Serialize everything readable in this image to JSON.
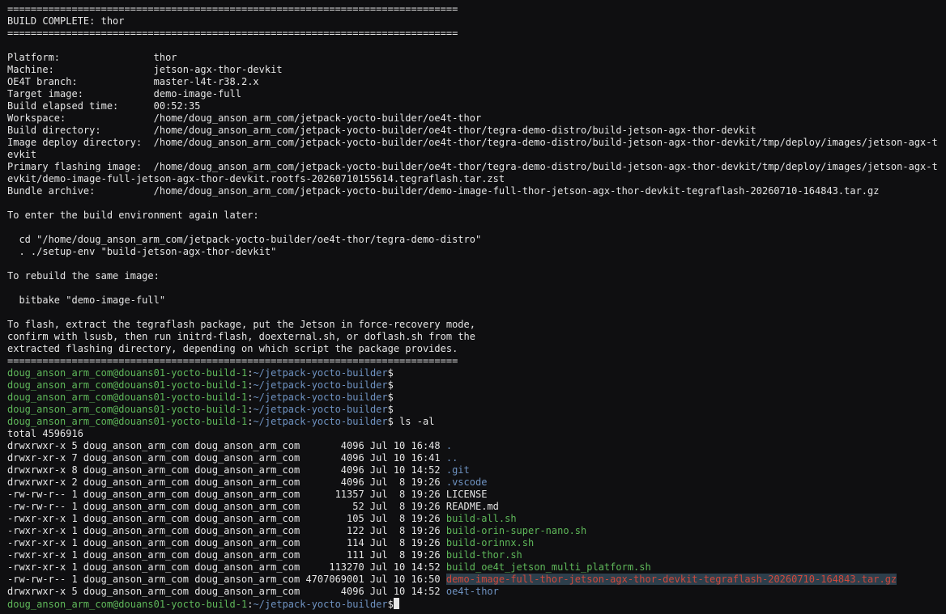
{
  "terminal": {
    "lines": [
      "=============================================================================",
      "BUILD COMPLETE: thor",
      "=============================================================================",
      "",
      "Platform:                thor",
      "Machine:                 jetson-agx-thor-devkit",
      "OE4T branch:             master-l4t-r38.2.x",
      "Target image:            demo-image-full",
      "Build elapsed time:      00:52:35",
      "Workspace:               /home/doug_anson_arm_com/jetpack-yocto-builder/oe4t-thor",
      "Build directory:         /home/doug_anson_arm_com/jetpack-yocto-builder/oe4t-thor/tegra-demo-distro/build-jetson-agx-thor-devkit",
      "Image deploy directory:  /home/doug_anson_arm_com/jetpack-yocto-builder/oe4t-thor/tegra-demo-distro/build-jetson-agx-thor-devkit/tmp/deploy/images/jetson-agx-thor-d",
      "evkit",
      "Primary flashing image:  /home/doug_anson_arm_com/jetpack-yocto-builder/oe4t-thor/tegra-demo-distro/build-jetson-agx-thor-devkit/tmp/deploy/images/jetson-agx-thor-d",
      "evkit/demo-image-full-jetson-agx-thor-devkit.rootfs-20260710155614.tegraflash.tar.zst",
      "Bundle archive:          /home/doug_anson_arm_com/jetpack-yocto-builder/demo-image-full-thor-jetson-agx-thor-devkit-tegraflash-20260710-164843.tar.gz",
      "",
      "To enter the build environment again later:",
      "",
      "  cd \"/home/doug_anson_arm_com/jetpack-yocto-builder/oe4t-thor/tegra-demo-distro\"",
      "  . ./setup-env \"build-jetson-agx-thor-devkit\"",
      "",
      "To rebuild the same image:",
      "",
      "  bitbake \"demo-image-full\"",
      "",
      "To flash, extract the tegraflash package, put the Jetson in force-recovery mode,",
      "confirm with lsusb, then run initrd-flash, doexternal.sh, or doflash.sh from the",
      "extracted flashing directory, depending on which script the package provides.",
      "============================================================================="
    ],
    "prompt": {
      "user_host": "doug_anson_arm_com@douans01-yocto-build-1",
      "sep": ":",
      "path": "~/jetpack-yocto-builder",
      "dollar": "$"
    },
    "command": " ls -al",
    "total": "total 4596916",
    "listing": [
      {
        "meta": "drwxrwxr-x 5 doug_anson_arm_com doug_anson_arm_com       4096 Jul 10 16:48 ",
        "name": ".",
        "color": "blue",
        "highlight": false
      },
      {
        "meta": "drwxr-xr-x 7 doug_anson_arm_com doug_anson_arm_com       4096 Jul 10 16:41 ",
        "name": "..",
        "color": "blue",
        "highlight": false
      },
      {
        "meta": "drwxrwxr-x 8 doug_anson_arm_com doug_anson_arm_com       4096 Jul 10 14:52 ",
        "name": ".git",
        "color": "blue",
        "highlight": false
      },
      {
        "meta": "drwxrwxr-x 2 doug_anson_arm_com doug_anson_arm_com       4096 Jul  8 19:26 ",
        "name": ".vscode",
        "color": "blue",
        "highlight": false
      },
      {
        "meta": "-rw-rw-r-- 1 doug_anson_arm_com doug_anson_arm_com      11357 Jul  8 19:26 ",
        "name": "LICENSE",
        "color": "plain",
        "highlight": false
      },
      {
        "meta": "-rw-rw-r-- 1 doug_anson_arm_com doug_anson_arm_com         52 Jul  8 19:26 ",
        "name": "README.md",
        "color": "plain",
        "highlight": false
      },
      {
        "meta": "-rwxr-xr-x 1 doug_anson_arm_com doug_anson_arm_com        105 Jul  8 19:26 ",
        "name": "build-all.sh",
        "color": "green",
        "highlight": false
      },
      {
        "meta": "-rwxr-xr-x 1 doug_anson_arm_com doug_anson_arm_com        122 Jul  8 19:26 ",
        "name": "build-orin-super-nano.sh",
        "color": "green",
        "highlight": false
      },
      {
        "meta": "-rwxr-xr-x 1 doug_anson_arm_com doug_anson_arm_com        114 Jul  8 19:26 ",
        "name": "build-orinnx.sh",
        "color": "green",
        "highlight": false
      },
      {
        "meta": "-rwxr-xr-x 1 doug_anson_arm_com doug_anson_arm_com        111 Jul  8 19:26 ",
        "name": "build-thor.sh",
        "color": "green",
        "highlight": false
      },
      {
        "meta": "-rwxr-xr-x 1 doug_anson_arm_com doug_anson_arm_com     113270 Jul 10 14:52 ",
        "name": "build_oe4t_jetson_multi_platform.sh",
        "color": "green",
        "highlight": false
      },
      {
        "meta": "-rw-rw-r-- 1 doug_anson_arm_com doug_anson_arm_com 4707069001 Jul 10 16:50 ",
        "name": "demo-image-full-thor-jetson-agx-thor-devkit-tegraflash-20260710-164843.tar.gz",
        "color": "red",
        "highlight": true
      },
      {
        "meta": "drwxrwxr-x 5 doug_anson_arm_com doug_anson_arm_com       4096 Jul 10 14:52 ",
        "name": "oe4t-thor",
        "color": "blue",
        "highlight": false
      }
    ],
    "colors": {
      "background": "#0f0f11",
      "text": "#e6e6e6",
      "prompt_user": "#5fb85a",
      "prompt_path": "#6f93c2",
      "archive": "#d0493c",
      "highlight_bg": "#2d3f4c"
    }
  }
}
